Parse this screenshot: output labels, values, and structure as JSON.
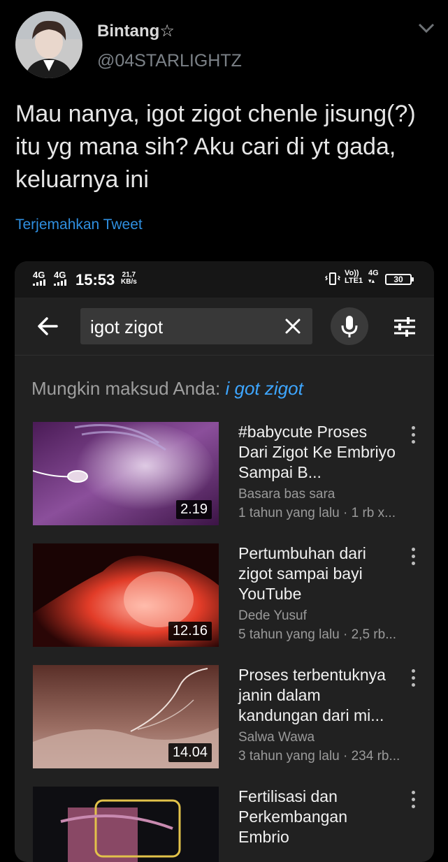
{
  "tweet": {
    "display_name": "Bintang☆",
    "handle": "@04STARLIGHTZ",
    "text": "Mau nanya, igot zigot chenle jisung(?) itu yg mana sih? Aku cari di yt gada, keluarnya ini",
    "translate_label": "Terjemahkan Tweet"
  },
  "status_bar": {
    "sim1": "4G",
    "sim2": "4G",
    "time": "15:53",
    "speed_value": "21,7",
    "speed_unit": "KB/s",
    "volte": "Vo))",
    "lte": "LTE1",
    "net": "4G",
    "battery": "30"
  },
  "search": {
    "query": "igot zigot"
  },
  "suggestion": {
    "prefix": "Mungkin maksud Anda: ",
    "link": "i got zigot"
  },
  "videos": [
    {
      "title": "#babycute Proses Dari Zigot Ke Embriyo Sampai B...",
      "channel": "Basara bas sara",
      "meta": "1 tahun yang lalu · 1 rb x...",
      "duration": "2.19"
    },
    {
      "title": "Pertumbuhan dari zigot sampai bayi YouTube",
      "channel": "Dede Yusuf",
      "meta": "5 tahun yang lalu · 2,5 rb...",
      "duration": "12.16"
    },
    {
      "title": "Proses terbentuknya janin dalam kandungan dari mi...",
      "channel": "Salwa Wawa",
      "meta": "3 tahun yang lalu · 234 rb...",
      "duration": "14.04"
    },
    {
      "title": "Fertilisasi dan Perkembangan Embrio",
      "channel": "",
      "meta": "",
      "duration": ""
    }
  ],
  "icons": {
    "chevron": "chevron-down-icon",
    "back": "arrow-left-icon",
    "clear": "close-icon",
    "mic": "microphone-icon",
    "filter": "filter-sliders-icon",
    "more": "more-vertical-icon"
  },
  "colors": {
    "background": "#000000",
    "link_blue": "#2f8fe0",
    "yt_link": "#3ea6ff",
    "card_bg": "#212121"
  }
}
